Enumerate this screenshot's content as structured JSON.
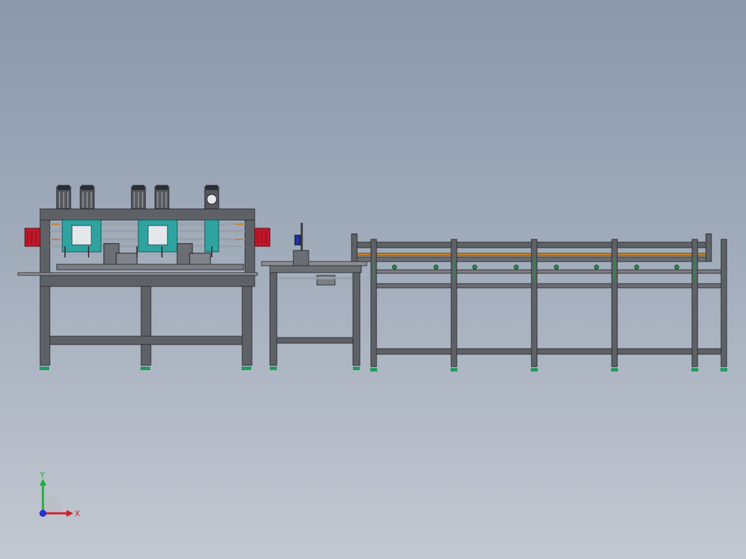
{
  "viewport": {
    "background_top": "#8b98ab",
    "background_bottom": "#c3c8d1"
  },
  "model": {
    "frame_color": "#5e6166",
    "frame_dark": "#3a3c40",
    "frame_light": "#8a8d92",
    "panel_accent": "#2fa3a0",
    "motor_red": "#c0172a",
    "foot_green": "#1f9c5a",
    "blue_part": "#2230a8",
    "orange_rail": "#c9832c",
    "conveyor_green": "#2f8a4a"
  },
  "triad": {
    "x_label": "X",
    "y_label": "Y",
    "x_color": "#d0202a",
    "y_color": "#1cae3a",
    "z_color": "#2230d0",
    "sector_color": "#b8bcc4"
  }
}
